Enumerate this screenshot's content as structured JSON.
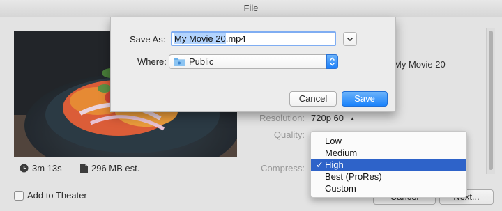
{
  "window": {
    "title": "File"
  },
  "movie": {
    "title": "My Movie 20",
    "duration": "3m 13s",
    "size": "296 MB est."
  },
  "settings": {
    "resolution_label": "Resolution:",
    "resolution_value": "720p 60",
    "quality_label": "Quality:",
    "compress_label": "Compress:"
  },
  "quality_menu": {
    "items": [
      "Low",
      "Medium",
      "High",
      "Best (ProRes)",
      "Custom"
    ],
    "selected": "High"
  },
  "footer": {
    "add_to_theater": "Add to Theater",
    "cancel": "Cancel",
    "next": "Next..."
  },
  "save_dialog": {
    "save_as_label": "Save As:",
    "filename_base": "My Movie 20",
    "filename_ext": ".mp4",
    "where_label": "Where:",
    "where_value": "Public",
    "cancel": "Cancel",
    "save": "Save"
  },
  "colors": {
    "accent": "#1a82fb",
    "menu_highlight": "#2e63c9"
  }
}
